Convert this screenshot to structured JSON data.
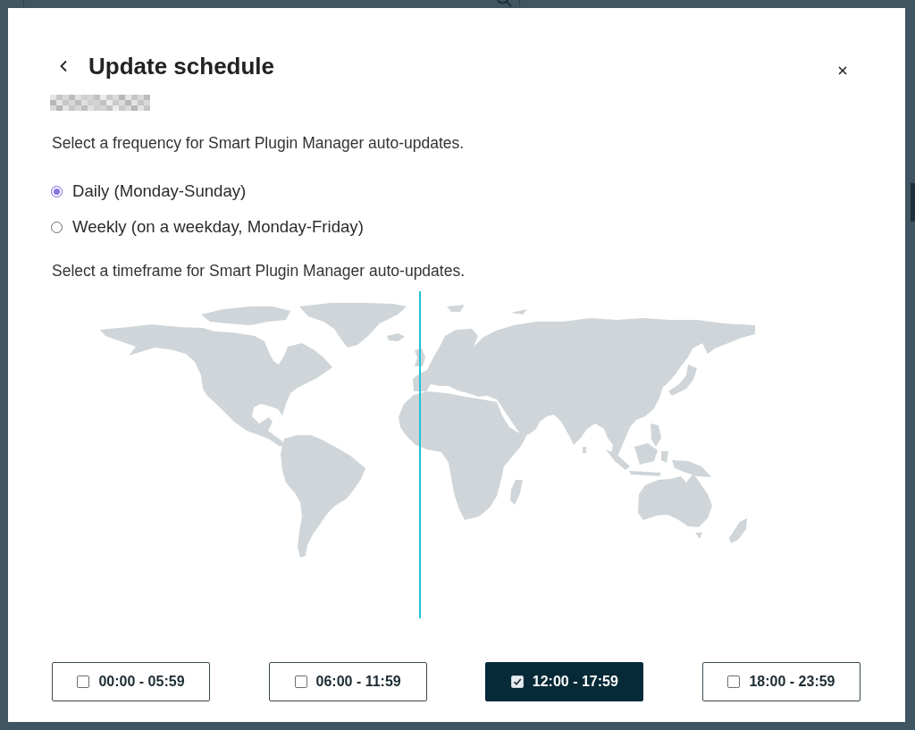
{
  "dialog": {
    "title": "Update schedule",
    "frequency_prompt": "Select a frequency for Smart Plugin Manager auto-updates.",
    "frequency_options": [
      {
        "label": "Daily (Monday-Sunday)",
        "selected": true
      },
      {
        "label": "Weekly (on a weekday, Monday-Friday)",
        "selected": false
      }
    ],
    "timeframe_prompt": "Select a timeframe for Smart Plugin Manager auto-updates.",
    "time_slots": [
      {
        "label": "00:00 - 05:59",
        "checked": false
      },
      {
        "label": "06:00 - 11:59",
        "checked": false
      },
      {
        "label": "12:00 - 17:59",
        "checked": true
      },
      {
        "label": "18:00 - 23:59",
        "checked": false
      }
    ]
  }
}
